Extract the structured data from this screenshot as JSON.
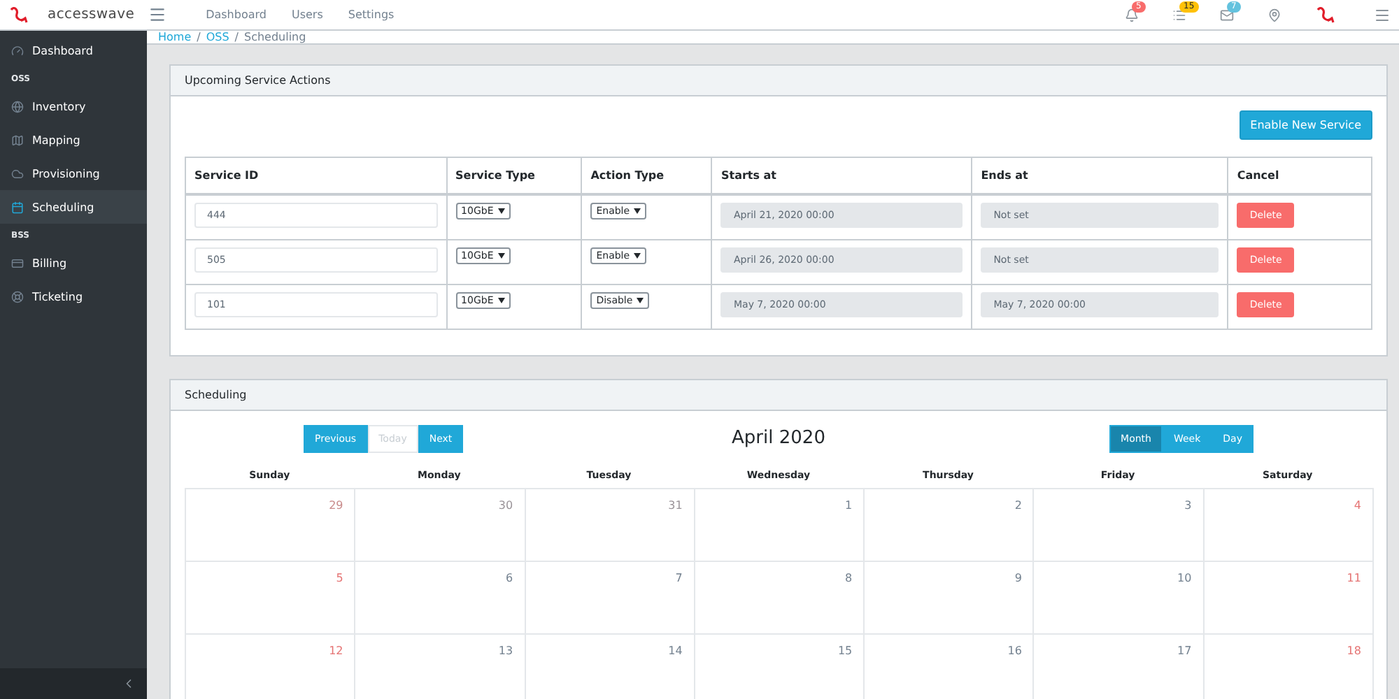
{
  "header": {
    "brand": "accesswave",
    "nav": [
      "Dashboard",
      "Users",
      "Settings"
    ],
    "badges": [
      {
        "count": "5",
        "color": "#f86c6b"
      },
      {
        "count": "15",
        "color": "#ffc107"
      },
      {
        "count": "7",
        "color": "#63c2de"
      }
    ]
  },
  "sidebar": {
    "items": [
      {
        "kind": "item",
        "label": "Dashboard",
        "selected": false
      },
      {
        "kind": "heading",
        "label": "OSS"
      },
      {
        "kind": "item",
        "label": "Inventory",
        "selected": false
      },
      {
        "kind": "item",
        "label": "Mapping",
        "selected": false
      },
      {
        "kind": "item",
        "label": "Provisioning",
        "selected": false
      },
      {
        "kind": "item",
        "label": "Scheduling",
        "selected": true
      },
      {
        "kind": "heading",
        "label": "BSS"
      },
      {
        "kind": "item",
        "label": "Billing",
        "selected": false
      },
      {
        "kind": "item",
        "label": "Ticketing",
        "selected": false
      }
    ]
  },
  "breadcrumb": {
    "separator": "/",
    "items": [
      {
        "label": "Home",
        "link": true
      },
      {
        "label": "OSS",
        "link": true
      },
      {
        "label": "Scheduling",
        "link": false
      }
    ]
  },
  "upcoming": {
    "title": "Upcoming Service Actions",
    "button": "Enable New Service",
    "columns": [
      "Service ID",
      "Service Type",
      "Action Type",
      "Starts at",
      "Ends at",
      "Cancel"
    ],
    "rows": [
      {
        "id": "444",
        "service_type": "10GbE",
        "action": "Enable",
        "starts": "April 21, 2020 00:00",
        "ends": "Not set",
        "cancel": "Delete"
      },
      {
        "id": "505",
        "service_type": "10GbE",
        "action": "Enable",
        "starts": "April 26, 2020 00:00",
        "ends": "Not set",
        "cancel": "Delete"
      },
      {
        "id": "101",
        "service_type": "10GbE",
        "action": "Disable",
        "starts": "May 7, 2020 00:00",
        "ends": "May 7, 2020 00:00",
        "cancel": "Delete"
      }
    ]
  },
  "scheduling": {
    "title": "Scheduling",
    "month": "April 2020",
    "nav_buttons": [
      {
        "label": "Previous",
        "disabled": false
      },
      {
        "label": "Today",
        "disabled": true
      },
      {
        "label": "Next",
        "disabled": false
      }
    ],
    "views": [
      {
        "label": "Month",
        "selected": true
      },
      {
        "label": "Week",
        "selected": false
      },
      {
        "label": "Day",
        "selected": false
      }
    ],
    "weekdays": [
      "Sunday",
      "Monday",
      "Tuesday",
      "Wednesday",
      "Thursday",
      "Friday",
      "Saturday"
    ],
    "weeks": [
      [
        {
          "day": "29",
          "muted": true
        },
        {
          "day": "30",
          "muted": true
        },
        {
          "day": "31",
          "muted": true
        },
        {
          "day": "1",
          "muted": false
        },
        {
          "day": "2",
          "muted": false
        },
        {
          "day": "3",
          "muted": false
        },
        {
          "day": "4",
          "muted": false
        }
      ],
      [
        {
          "day": "5",
          "muted": false
        },
        {
          "day": "6",
          "muted": false
        },
        {
          "day": "7",
          "muted": false
        },
        {
          "day": "8",
          "muted": false
        },
        {
          "day": "9",
          "muted": false
        },
        {
          "day": "10",
          "muted": false
        },
        {
          "day": "11",
          "muted": false
        }
      ],
      [
        {
          "day": "12",
          "muted": false
        },
        {
          "day": "13",
          "muted": false
        },
        {
          "day": "14",
          "muted": false
        },
        {
          "day": "15",
          "muted": false
        },
        {
          "day": "16",
          "muted": false
        },
        {
          "day": "17",
          "muted": false
        },
        {
          "day": "18",
          "muted": false
        }
      ]
    ]
  }
}
